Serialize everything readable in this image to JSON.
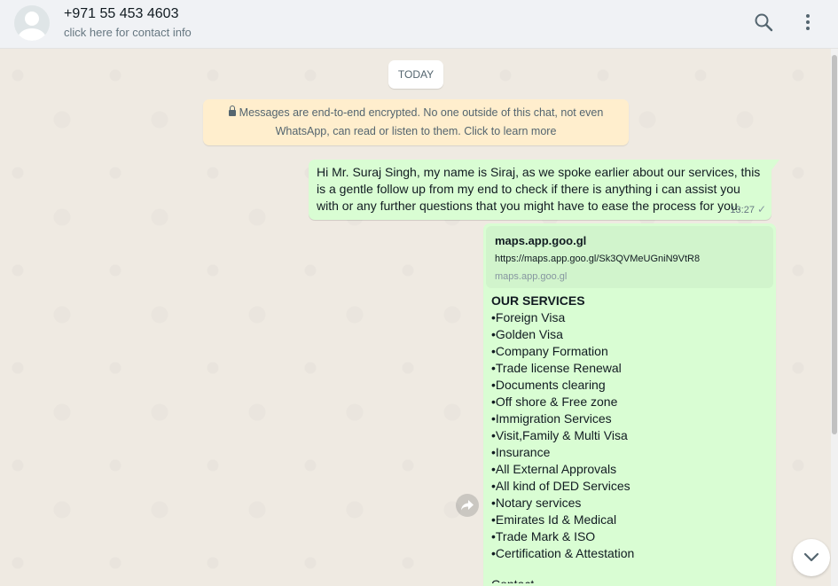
{
  "header": {
    "contact_name": "+971 55 453 4603",
    "contact_subtitle": "click here for contact info",
    "icons": [
      "avatar",
      "search-icon",
      "menu-icon"
    ]
  },
  "chat": {
    "date_label": "TODAY",
    "encryption_notice": "Messages are end-to-end encrypted. No one outside of this chat, not even WhatsApp, can read or listen to them. Click to learn more",
    "messages": [
      {
        "text": "Hi Mr. Suraj Singh, my name is Siraj, as we spoke earlier about our services, this is a gentle follow up from my end to check if there is anything i can assist you with or any further questions that you might have to ease the process for you.",
        "time": "13:27",
        "status": "sent"
      },
      {
        "link_preview": {
          "title": "maps.app.goo.gl",
          "url": "https://maps.app.goo.gl/Sk3QVMeUGniN9VtR8",
          "domain": "maps.app.goo.gl"
        },
        "heading": "OUR SERVICES",
        "items": [
          "•Foreign Visa",
          "•Golden Visa",
          "•Company Formation",
          "•Trade license Renewal",
          "•Documents clearing",
          "•Off shore & Free zone",
          "•Immigration Services",
          "•Visit,Family & Multi Visa",
          "•Insurance",
          "•All External Approvals",
          "•All kind of DED Services",
          "•Notary services",
          "•Emirates Id & Medical",
          "•Trade Mark & ISO",
          "•Certification & Attestation"
        ],
        "cut_off_text": "Contact"
      }
    ]
  },
  "colors": {
    "outgoing_bubble": "#d9fdd3",
    "link_card": "#d1f4cc",
    "chat_background": "#efeae2",
    "encryption_banner": "#ffeecd"
  }
}
